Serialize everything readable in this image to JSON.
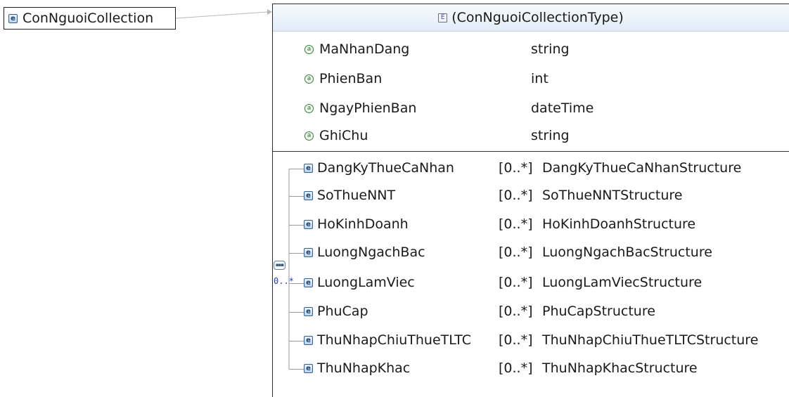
{
  "root_element": {
    "name": "ConNguoiCollection",
    "icon": "element-icon",
    "icon_glyph": "e"
  },
  "complex_type": {
    "name": "(ConNguoiCollectionType)",
    "icon": "complex-type-icon",
    "icon_glyph": "E"
  },
  "attributes": [
    {
      "name": "MaNhanDang",
      "type": "string",
      "icon_glyph": "a"
    },
    {
      "name": "PhienBan",
      "type": "int",
      "icon_glyph": "a"
    },
    {
      "name": "NgayPhienBan",
      "type": "dateTime",
      "icon_glyph": "a"
    },
    {
      "name": "GhiChu",
      "type": "string",
      "icon_glyph": "a"
    }
  ],
  "sequence": {
    "cardinality": "0..*",
    "icon": "sequence-compositor-icon",
    "glyph": "▪▪▪"
  },
  "elements": [
    {
      "name": "DangKyThueCaNhan",
      "cardinality": "[0..*]",
      "type": "DangKyThueCaNhanStructure",
      "icon_glyph": "e"
    },
    {
      "name": "SoThueNNT",
      "cardinality": "[0..*]",
      "type": "SoThueNNTStructure",
      "icon_glyph": "e"
    },
    {
      "name": "HoKinhDoanh",
      "cardinality": "[0..*]",
      "type": "HoKinhDoanhStructure",
      "icon_glyph": "e"
    },
    {
      "name": "LuongNgachBac",
      "cardinality": "[0..*]",
      "type": "LuongNgachBacStructure",
      "icon_glyph": "e"
    },
    {
      "name": "LuongLamViec",
      "cardinality": "[0..*]",
      "type": "LuongLamViecStructure",
      "icon_glyph": "e"
    },
    {
      "name": "PhuCap",
      "cardinality": "[0..*]",
      "type": "PhuCapStructure",
      "icon_glyph": "e"
    },
    {
      "name": "ThuNhapChiuThueTLTC",
      "cardinality": "[0..*]",
      "type": "ThuNhapChiuThueTLTCStructure",
      "icon_glyph": "e"
    },
    {
      "name": "ThuNhapKhac",
      "cardinality": "[0..*]",
      "type": "ThuNhapKhacStructure",
      "icon_glyph": "e"
    }
  ],
  "colors": {
    "element_icon": "#355f8c",
    "attribute_icon": "#3b7a3b",
    "cardinality_text": "#1a3fc0",
    "header_gradient_top": "#f7fafd",
    "header_gradient_bottom": "#e2ecf7"
  }
}
